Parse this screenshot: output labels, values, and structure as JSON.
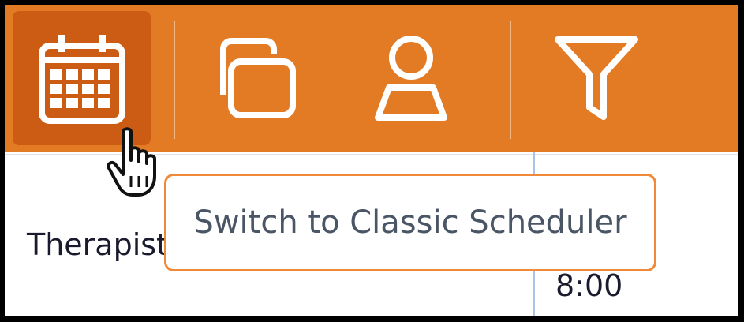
{
  "toolbar": {
    "buttons": [
      {
        "icon": "calendar-icon",
        "active": true
      },
      {
        "icon": "copy-windows-icon",
        "active": false
      },
      {
        "icon": "user-icon",
        "active": false
      },
      {
        "icon": "filter-icon",
        "active": false
      }
    ],
    "colors": {
      "background": "#e37b25",
      "active": "#cc5c14",
      "icon": "#ffffff"
    }
  },
  "grid": {
    "row_label": "Therapist",
    "time_label": "8:00"
  },
  "tooltip": {
    "text": "Switch to Classic Scheduler",
    "border_color": "#f08a3a"
  }
}
